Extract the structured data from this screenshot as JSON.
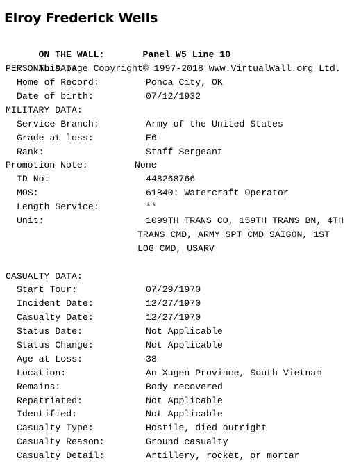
{
  "page": {
    "title": "Elroy Frederick Wells",
    "background_color": "#ffffff",
    "text_color": "#000000"
  },
  "wall": {
    "label": "ON THE WALL:",
    "value": "Panel W5 Line 10"
  },
  "copyright": "This page Copyright© 1997-2018 www.VirtualWall.org Ltd.",
  "sections": [
    {
      "heading": "PERSONAL DATA:",
      "fields": [
        {
          "label": "Home of Record:",
          "value": "Ponca City, OK",
          "indent": 2
        },
        {
          "label": "Date of birth:",
          "value": "07/12/1932",
          "indent": 2
        }
      ]
    },
    {
      "heading": "MILITARY DATA:",
      "fields": [
        {
          "label": "Service Branch:",
          "value": "Army of the United States",
          "indent": 2
        },
        {
          "label": "Grade at loss:",
          "value": "E6",
          "indent": 2
        },
        {
          "label": "Rank:",
          "value": "Staff Sergeant",
          "indent": 2
        },
        {
          "label": "Promotion Note:",
          "value": "None",
          "indent": 0
        },
        {
          "label": "ID No:",
          "value": "448268766",
          "indent": 2
        },
        {
          "label": "MOS:",
          "value": "61B40: Watercraft Operator",
          "indent": 2
        },
        {
          "label": "Length Service:",
          "value": "**",
          "indent": 2
        },
        {
          "label": "Unit:",
          "value": "1099TH TRANS CO, 159TH TRANS BN, 4TH",
          "indent": 2,
          "continuation": [
            "TRANS CMD, ARMY SPT CMD SAIGON, 1ST",
            "LOG CMD, USARV"
          ]
        }
      ]
    },
    {
      "heading": "CASUALTY DATA:",
      "blank_line_before": true,
      "fields": [
        {
          "label": "Start Tour:",
          "value": "07/29/1970",
          "indent": 2
        },
        {
          "label": "Incident Date:",
          "value": "12/27/1970",
          "indent": 2
        },
        {
          "label": "Casualty Date:",
          "value": "12/27/1970",
          "indent": 2
        },
        {
          "label": "Status Date:",
          "value": "Not Applicable",
          "indent": 2
        },
        {
          "label": "Status Change:",
          "value": "Not Applicable",
          "indent": 2
        },
        {
          "label": "Age at Loss:",
          "value": "38",
          "indent": 2
        },
        {
          "label": "Location:",
          "value": "An Xugen Province, South Vietnam",
          "indent": 2
        },
        {
          "label": "Remains:",
          "value": "Body recovered",
          "indent": 2
        },
        {
          "label": "Repatriated:",
          "value": "Not Applicable",
          "indent": 2
        },
        {
          "label": "Identified:",
          "value": "Not Applicable",
          "indent": 2
        },
        {
          "label": "Casualty Type:",
          "value": "Hostile, died outright",
          "indent": 2
        },
        {
          "label": "Casualty Reason:",
          "value": "Ground casualty",
          "indent": 2
        },
        {
          "label": "Casualty Detail:",
          "value": "Artillery, rocket, or mortar",
          "indent": 2
        }
      ]
    }
  ]
}
